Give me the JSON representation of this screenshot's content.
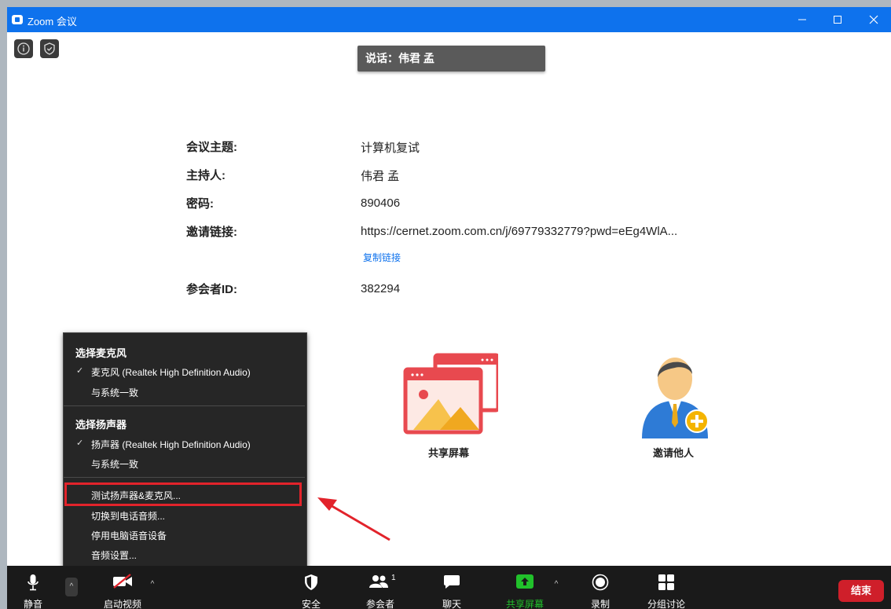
{
  "window": {
    "title": "Zoom 会议"
  },
  "speaking": {
    "text": "说话：伟君 孟"
  },
  "meeting_info": {
    "topic_label": "会议主题:",
    "topic": "计算机复试",
    "host_label": "主持人:",
    "host": "伟君 孟",
    "password_label": "密码:",
    "password": "890406",
    "invite_label": "邀请链接:",
    "invite_url": "https://cernet.zoom.com.cn/j/69779332779?pwd=eEg4WlA...",
    "copy_link": "复制链接",
    "participant_id_label": "参会者ID:",
    "participant_id": "382294"
  },
  "actions": {
    "share_screen": "共享屏幕",
    "invite_others": "邀请他人"
  },
  "audio_menu": {
    "mic_header": "选择麦克风",
    "mic_device": "麦克风 (Realtek High Definition Audio)",
    "mic_same_as_system": "与系统一致",
    "speaker_header": "选择扬声器",
    "speaker_device": "扬声器 (Realtek High Definition Audio)",
    "speaker_same_as_system": "与系统一致",
    "test": "测试扬声器&麦克风...",
    "switch_phone": "切换到电话音频...",
    "leave_audio": "停用电脑语音设备",
    "audio_settings": "音频设置..."
  },
  "toolbar": {
    "mute": "静音",
    "start_video": "启动视频",
    "security": "安全",
    "participants": "参会者",
    "participants_count": "1",
    "chat": "聊天",
    "share": "共享屏幕",
    "record": "录制",
    "breakout": "分组讨论",
    "end": "结束"
  },
  "colors": {
    "accent": "#0e72ed",
    "share_green": "#21c12b",
    "end_red": "#cf1f2a",
    "highlight_red": "#e2232b"
  },
  "icons": [
    "info-icon",
    "shield-check-icon",
    "microphone-icon",
    "video-off-icon",
    "security-shield-icon",
    "participants-icon",
    "chat-icon",
    "share-up-arrow-icon",
    "record-icon",
    "breakout-grid-icon"
  ]
}
